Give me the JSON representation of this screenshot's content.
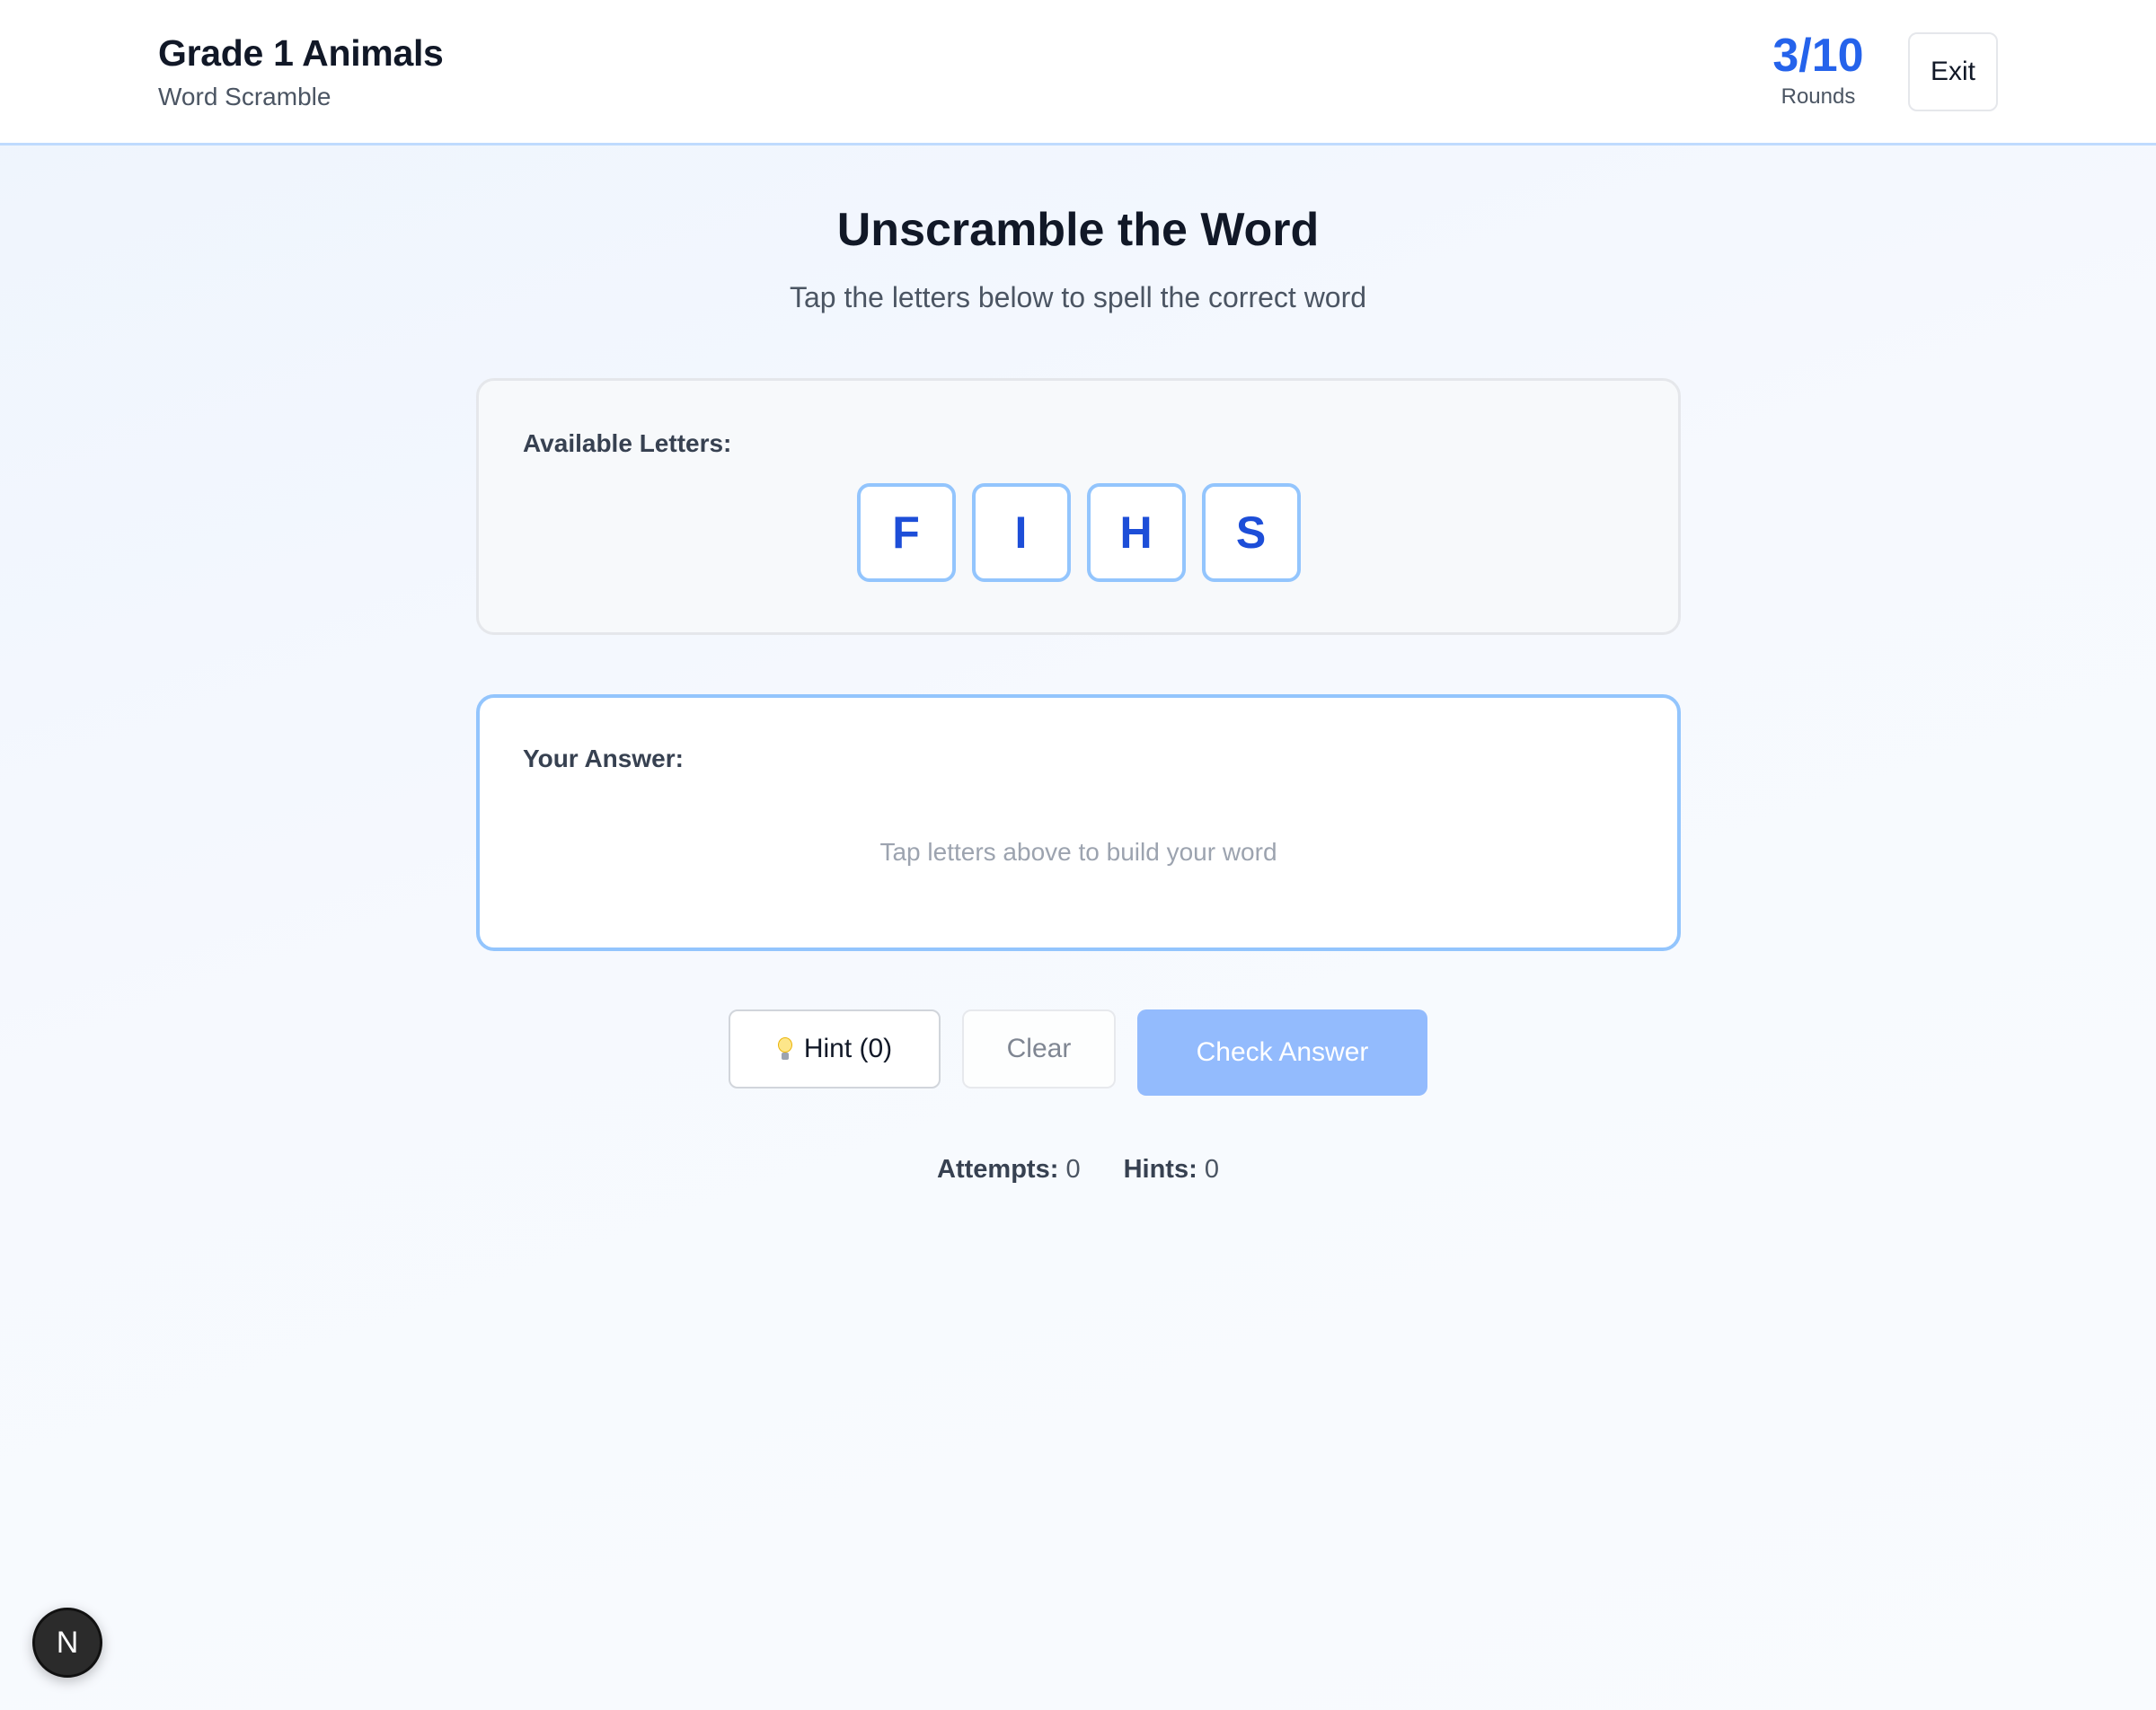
{
  "header": {
    "title": "Grade 1 Animals",
    "subtitle": "Word Scramble",
    "rounds_value": "3/10",
    "rounds_label": "Rounds",
    "exit_label": "Exit"
  },
  "main": {
    "title": "Unscramble the Word",
    "subtitle": "Tap the letters below to spell the correct word"
  },
  "letters": {
    "label": "Available Letters:",
    "tiles": [
      "F",
      "I",
      "H",
      "S"
    ]
  },
  "answer": {
    "label": "Your Answer:",
    "placeholder": "Tap letters above to build your word"
  },
  "actions": {
    "hint_label": "Hint (0)",
    "hint_icon": "lightbulb-icon",
    "clear_label": "Clear",
    "check_label": "Check Answer"
  },
  "stats": {
    "attempts_label": "Attempts:",
    "attempts_value": "0",
    "hints_label": "Hints:",
    "hints_value": "0"
  },
  "badge": {
    "letter": "N"
  },
  "colors": {
    "accent": "#2563eb",
    "tile_text": "#1d4ed8",
    "tile_border": "#93c5fd",
    "check_button_disabled": "#93bbfd"
  }
}
